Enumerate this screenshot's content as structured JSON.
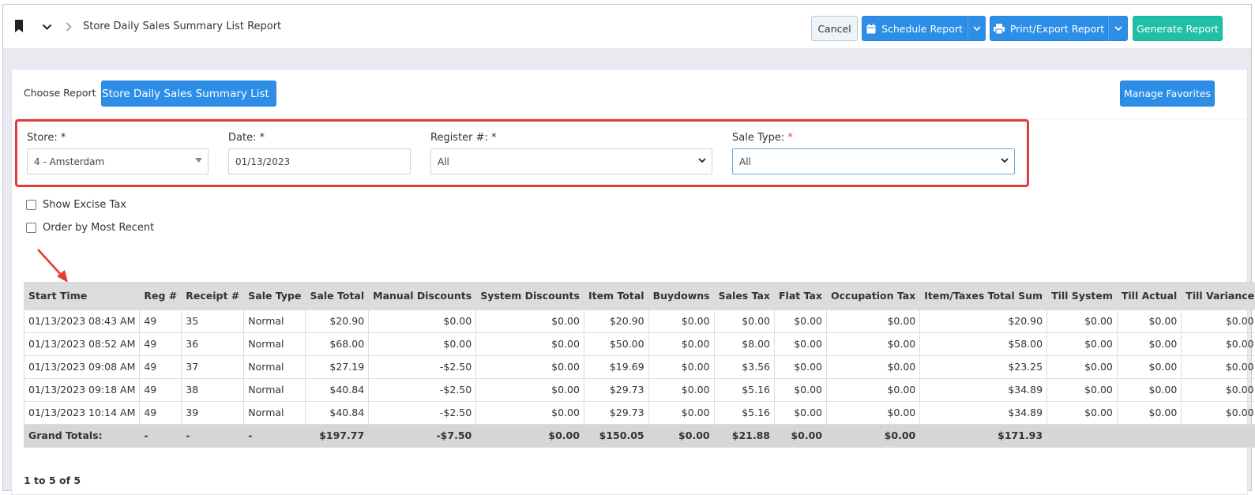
{
  "header": {
    "title": "Store Daily Sales Summary List Report",
    "cancel_label": "Cancel",
    "schedule_label": "Schedule Report",
    "print_label": "Print/Export Report",
    "generate_label": "Generate Report"
  },
  "report": {
    "choose_label": "Choose Report",
    "selected_report": "Store Daily Sales Summary List",
    "favorites_label": "Manage Favorites"
  },
  "filters": {
    "store_label": "Store: *",
    "store_value": "4 - Amsterdam",
    "date_label": "Date: *",
    "date_value": "01/13/2023",
    "register_label": "Register #: *",
    "register_value": "All",
    "saletype_label": "Sale Type:",
    "saletype_req": "*",
    "saletype_value": "All"
  },
  "options": {
    "excise_label": "Show Excise Tax",
    "recent_label": "Order by Most Recent"
  },
  "table": {
    "columns": [
      "Start Time",
      "Reg #",
      "Receipt #",
      "Sale Type",
      "Sale Total",
      "Manual Discounts",
      "System Discounts",
      "Item Total",
      "Buydowns",
      "Sales Tax",
      "Flat Tax",
      "Occupation Tax",
      "Item/Taxes Total Sum",
      "Till System",
      "Till Actual",
      "Till Variance"
    ],
    "rows": [
      [
        "01/13/2023 08:43 AM",
        "49",
        "35",
        "Normal",
        "$20.90",
        "$0.00",
        "$0.00",
        "$20.90",
        "$0.00",
        "$0.00",
        "$0.00",
        "$0.00",
        "$20.90",
        "$0.00",
        "$0.00",
        "$0.00"
      ],
      [
        "01/13/2023 08:52 AM",
        "49",
        "36",
        "Normal",
        "$68.00",
        "$0.00",
        "$0.00",
        "$50.00",
        "$0.00",
        "$8.00",
        "$0.00",
        "$0.00",
        "$58.00",
        "$0.00",
        "$0.00",
        "$0.00"
      ],
      [
        "01/13/2023 09:08 AM",
        "49",
        "37",
        "Normal",
        "$27.19",
        "-$2.50",
        "$0.00",
        "$19.69",
        "$0.00",
        "$3.56",
        "$0.00",
        "$0.00",
        "$23.25",
        "$0.00",
        "$0.00",
        "$0.00"
      ],
      [
        "01/13/2023 09:18 AM",
        "49",
        "38",
        "Normal",
        "$40.84",
        "-$2.50",
        "$0.00",
        "$29.73",
        "$0.00",
        "$5.16",
        "$0.00",
        "$0.00",
        "$34.89",
        "$0.00",
        "$0.00",
        "$0.00"
      ],
      [
        "01/13/2023 10:14 AM",
        "49",
        "39",
        "Normal",
        "$40.84",
        "-$2.50",
        "$0.00",
        "$29.73",
        "$0.00",
        "$5.16",
        "$0.00",
        "$0.00",
        "$34.89",
        "$0.00",
        "$0.00",
        "$0.00"
      ]
    ],
    "totals": [
      "Grand Totals:",
      "-",
      "-",
      "-",
      "$197.77",
      "-$7.50",
      "$0.00",
      "$150.05",
      "$0.00",
      "$21.88",
      "$0.00",
      "$0.00",
      "$171.93",
      "",
      "",
      ""
    ]
  },
  "pager": {
    "text": "1 to 5 of 5"
  },
  "colors": {
    "blue": "#2d8ee8",
    "teal": "#1fbfa8",
    "highlight": "#e53b3b"
  }
}
